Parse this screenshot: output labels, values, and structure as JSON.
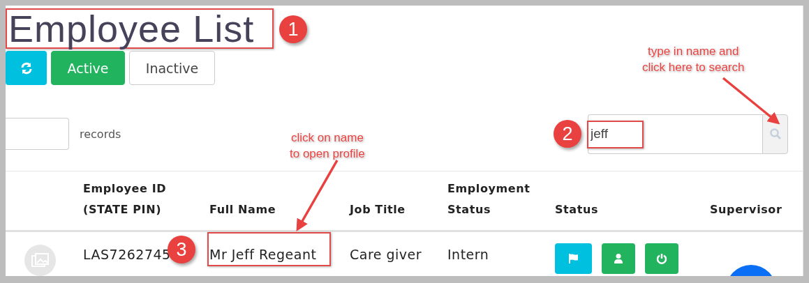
{
  "title": "Employee List",
  "filter_buttons": [
    {
      "kind": "refresh"
    },
    {
      "kind": "filter",
      "label": "Active",
      "selected": true
    },
    {
      "kind": "filter",
      "label": "Inactive",
      "selected": false
    }
  ],
  "records_label": "records",
  "search": {
    "value": "jeff"
  },
  "table": {
    "columns": [
      "Employee ID\n(STATE PIN)",
      "Full Name",
      "Job Title",
      "Employment\nStatus",
      "Status",
      "Supervisor"
    ],
    "rows": [
      {
        "employee_id": "LAS7262745",
        "full_name": "Mr Jeff Regeant",
        "job_title": "Care giver",
        "employment_status": "Intern",
        "actions": [
          {
            "kind": "flag"
          },
          {
            "kind": "user"
          },
          {
            "kind": "power"
          }
        ]
      }
    ]
  },
  "annotations": [
    {
      "number": "1"
    },
    {
      "number": "2"
    },
    {
      "number": "3"
    }
  ],
  "callouts": [
    {
      "text": "type in name and\nclick here to search"
    },
    {
      "text": "click on name\nto open profile"
    }
  ]
}
